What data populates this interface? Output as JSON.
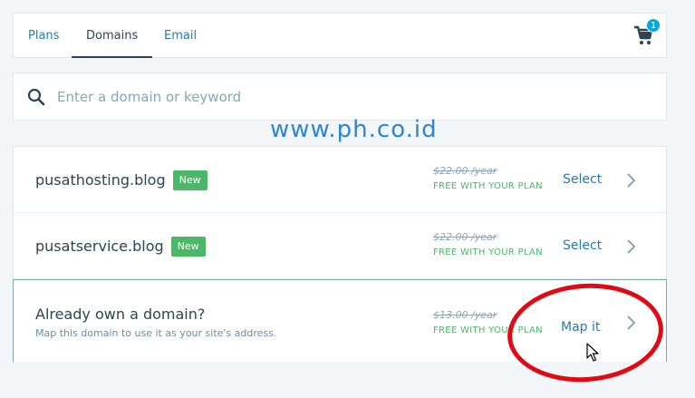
{
  "tabs": [
    {
      "label": "Plans"
    },
    {
      "label": "Domains",
      "active": true
    },
    {
      "label": "Email"
    }
  ],
  "cart": {
    "count": "1",
    "icon": "cart-icon"
  },
  "search": {
    "placeholder": "Enter a domain or keyword",
    "value": "",
    "icon": "search-icon"
  },
  "watermark": "www.ph.co.id",
  "results": [
    {
      "domain": "pusathosting.blog",
      "badge": "New",
      "price": "$22.00 /year",
      "note": "FREE WITH YOUR PLAN",
      "action": "Select"
    },
    {
      "domain": "pusatservice.blog",
      "badge": "New",
      "price": "$22.00 /year",
      "note": "FREE WITH YOUR PLAN",
      "action": "Select"
    }
  ],
  "own_domain": {
    "title": "Already own a domain?",
    "description": "Map this domain to use it as your site's address.",
    "price": "$13.00 /year",
    "note": "FREE WITH YOUR PLAN",
    "action": "Map it"
  },
  "colors": {
    "accent": "#2a7aa8",
    "badge_green": "#4ab866",
    "cart_badge": "#00aadc",
    "annotation_red": "#e00a14"
  }
}
